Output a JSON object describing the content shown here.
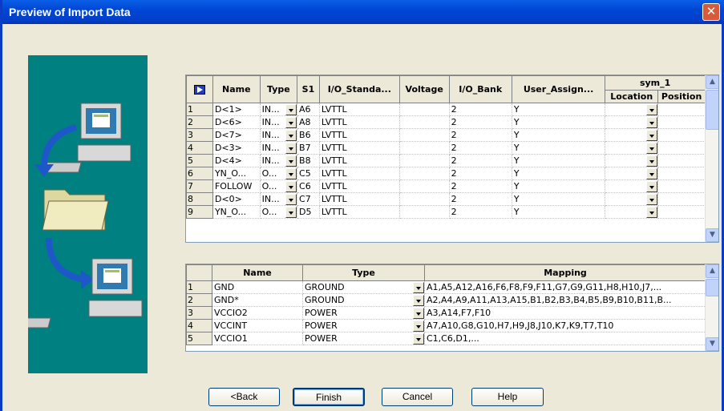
{
  "dialog": {
    "title": "Preview of Import Data"
  },
  "pin_table": {
    "headers": [
      "Name",
      "Type",
      "S1",
      "I/O_Standa...",
      "Voltage",
      "I/O_Bank",
      "User_Assign..."
    ],
    "group_header": "sym_1",
    "subheaders": [
      "Location",
      "Position"
    ],
    "rows": [
      {
        "n": "1",
        "name": "D<1>",
        "type": "IN...",
        "s1": "A6",
        "std": "LVTTL",
        "voltage": "",
        "bank": "2",
        "ua": "Y"
      },
      {
        "n": "2",
        "name": "D<6>",
        "type": "IN...",
        "s1": "A8",
        "std": "LVTTL",
        "voltage": "",
        "bank": "2",
        "ua": "Y"
      },
      {
        "n": "3",
        "name": "D<7>",
        "type": "IN...",
        "s1": "B6",
        "std": "LVTTL",
        "voltage": "",
        "bank": "2",
        "ua": "Y"
      },
      {
        "n": "4",
        "name": "D<3>",
        "type": "IN...",
        "s1": "B7",
        "std": "LVTTL",
        "voltage": "",
        "bank": "2",
        "ua": "Y"
      },
      {
        "n": "5",
        "name": "D<4>",
        "type": "IN...",
        "s1": "B8",
        "std": "LVTTL",
        "voltage": "",
        "bank": "2",
        "ua": "Y"
      },
      {
        "n": "6",
        "name": "YN_O...",
        "type": "O...",
        "s1": "C5",
        "std": "LVTTL",
        "voltage": "",
        "bank": "2",
        "ua": "Y"
      },
      {
        "n": "7",
        "name": "FOLLOW",
        "type": "O...",
        "s1": "C6",
        "std": "LVTTL",
        "voltage": "",
        "bank": "2",
        "ua": "Y"
      },
      {
        "n": "8",
        "name": "D<0>",
        "type": "IN...",
        "s1": "C7",
        "std": "LVTTL",
        "voltage": "",
        "bank": "2",
        "ua": "Y"
      },
      {
        "n": "9",
        "name": "YN_O...",
        "type": "O...",
        "s1": "D5",
        "std": "LVTTL",
        "voltage": "",
        "bank": "2",
        "ua": "Y"
      }
    ]
  },
  "power_table": {
    "headers": [
      "Name",
      "Type",
      "Mapping"
    ],
    "rows": [
      {
        "n": "1",
        "name": "GND",
        "type": "GROUND",
        "mapping": "A1,A5,A12,A16,F6,F8,F9,F11,G7,G9,G11,H8,H10,J7,..."
      },
      {
        "n": "2",
        "name": "GND*",
        "type": "GROUND",
        "mapping": "A2,A4,A9,A11,A13,A15,B1,B2,B3,B4,B5,B9,B10,B11,B..."
      },
      {
        "n": "3",
        "name": "VCCIO2",
        "type": "POWER",
        "mapping": "A3,A14,F7,F10"
      },
      {
        "n": "4",
        "name": "VCCINT",
        "type": "POWER",
        "mapping": "A7,A10,G8,G10,H7,H9,J8,J10,K7,K9,T7,T10"
      },
      {
        "n": "5",
        "name": "VCCIO1",
        "type": "POWER",
        "mapping": "C1,C6,D1,..."
      }
    ]
  },
  "buttons": {
    "back": "<Back",
    "finish": "Finish",
    "cancel": "Cancel",
    "help": "Help"
  }
}
